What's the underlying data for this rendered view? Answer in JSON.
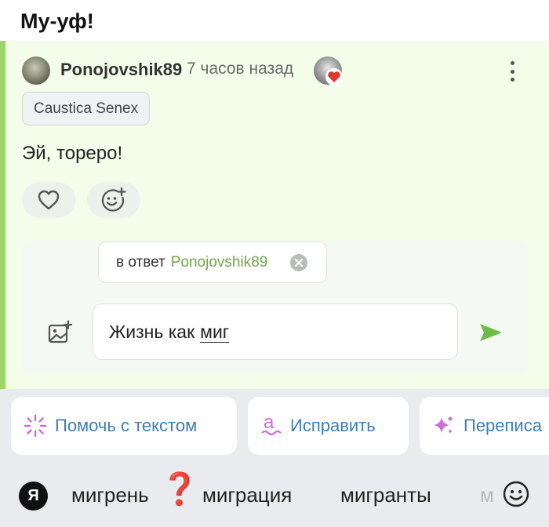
{
  "header": {
    "title": "Му-уф!"
  },
  "comment": {
    "username": "Ponojovshik89",
    "timestamp": "7 часов назад",
    "tag": "Caustica Senex",
    "text": "Эй, тореро!",
    "accent_color": "#9bd46a"
  },
  "reply": {
    "prefix": "в ответ",
    "target": "Ponojovshik89",
    "input_word_1": "Жизнь как",
    "input_word_2": "миг"
  },
  "ai_tools": [
    {
      "label": "Помочь с текстом",
      "icon": "sparkle-burst-icon"
    },
    {
      "label": "Исправить",
      "icon": "spellcheck-a-icon"
    },
    {
      "label": "Переписа",
      "icon": "sparkles-icon"
    }
  ],
  "keyboard": {
    "logo": "Я",
    "suggestions": [
      "мигрень",
      "миграция",
      "мигранты",
      "м"
    ],
    "qmark": "❓"
  }
}
